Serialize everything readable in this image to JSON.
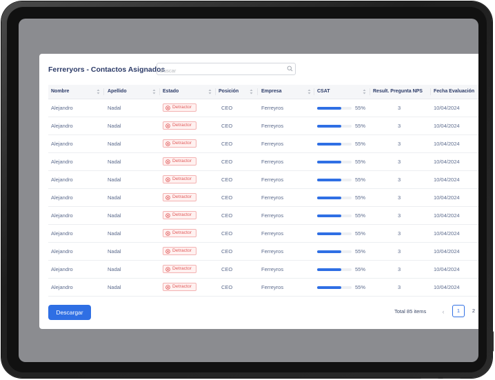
{
  "title": "Ferreryors - Contactos Asignados",
  "search": {
    "placeholder": "Buscar",
    "value": ""
  },
  "columns": [
    "Nombre",
    "Apellido",
    "Estado",
    "Posición",
    "Empresa",
    "CSAT",
    "Result. Pregunta NPS",
    "Fecha Evaluación"
  ],
  "rows": [
    {
      "nombre": "Alejandro",
      "apellido": "Nadal",
      "estado": "Detractor",
      "posicion": "CEO",
      "empresa": "Ferreyros",
      "csat_pct": 55,
      "csat_label": "55%",
      "nps": "3",
      "fecha": "10/04/2024"
    },
    {
      "nombre": "Alejandro",
      "apellido": "Nadal",
      "estado": "Detractor",
      "posicion": "CEO",
      "empresa": "Ferreyros",
      "csat_pct": 55,
      "csat_label": "55%",
      "nps": "3",
      "fecha": "10/04/2024"
    },
    {
      "nombre": "Alejandro",
      "apellido": "Nadal",
      "estado": "Detractor",
      "posicion": "CEO",
      "empresa": "Ferreyros",
      "csat_pct": 55,
      "csat_label": "55%",
      "nps": "3",
      "fecha": "10/04/2024"
    },
    {
      "nombre": "Alejandro",
      "apellido": "Nadal",
      "estado": "Detractor",
      "posicion": "CEO",
      "empresa": "Ferreyros",
      "csat_pct": 55,
      "csat_label": "55%",
      "nps": "3",
      "fecha": "10/04/2024"
    },
    {
      "nombre": "Alejandro",
      "apellido": "Nadal",
      "estado": "Detractor",
      "posicion": "CEO",
      "empresa": "Ferreyros",
      "csat_pct": 55,
      "csat_label": "55%",
      "nps": "3",
      "fecha": "10/04/2024"
    },
    {
      "nombre": "Alejandro",
      "apellido": "Nadal",
      "estado": "Detractor",
      "posicion": "CEO",
      "empresa": "Ferreyros",
      "csat_pct": 55,
      "csat_label": "55%",
      "nps": "3",
      "fecha": "10/04/2024"
    },
    {
      "nombre": "Alejandro",
      "apellido": "Nadal",
      "estado": "Detractor",
      "posicion": "CEO",
      "empresa": "Ferreyros",
      "csat_pct": 55,
      "csat_label": "55%",
      "nps": "3",
      "fecha": "10/04/2024"
    },
    {
      "nombre": "Alejandro",
      "apellido": "Nadal",
      "estado": "Detractor",
      "posicion": "CEO",
      "empresa": "Ferreyros",
      "csat_pct": 55,
      "csat_label": "55%",
      "nps": "3",
      "fecha": "10/04/2024"
    },
    {
      "nombre": "Alejandro",
      "apellido": "Nadal",
      "estado": "Detractor",
      "posicion": "CEO",
      "empresa": "Ferreyros",
      "csat_pct": 55,
      "csat_label": "55%",
      "nps": "3",
      "fecha": "10/04/2024"
    },
    {
      "nombre": "Alejandro",
      "apellido": "Nadal",
      "estado": "Detractor",
      "posicion": "CEO",
      "empresa": "Ferreyros",
      "csat_pct": 55,
      "csat_label": "55%",
      "nps": "3",
      "fecha": "10/04/2024"
    },
    {
      "nombre": "Alejandro",
      "apellido": "Nadal",
      "estado": "Detractor",
      "posicion": "CEO",
      "empresa": "Ferreyros",
      "csat_pct": 55,
      "csat_label": "55%",
      "nps": "3",
      "fecha": "10/04/2024"
    }
  ],
  "footer": {
    "download_label": "Descargar",
    "total_label": "Total 85 items",
    "pages": [
      "1",
      "2"
    ],
    "current_page": "1"
  },
  "icons": {
    "search": "search-icon",
    "sort": "sort-icon",
    "status": "close-circle-icon",
    "prev": "chevron-left-icon"
  },
  "colors": {
    "accent": "#2f6fe4",
    "title": "#2b3a67",
    "detractor": "#e05a5a",
    "detractor_bg": "#fff1f0",
    "screen_bg": "#8b8c90"
  }
}
